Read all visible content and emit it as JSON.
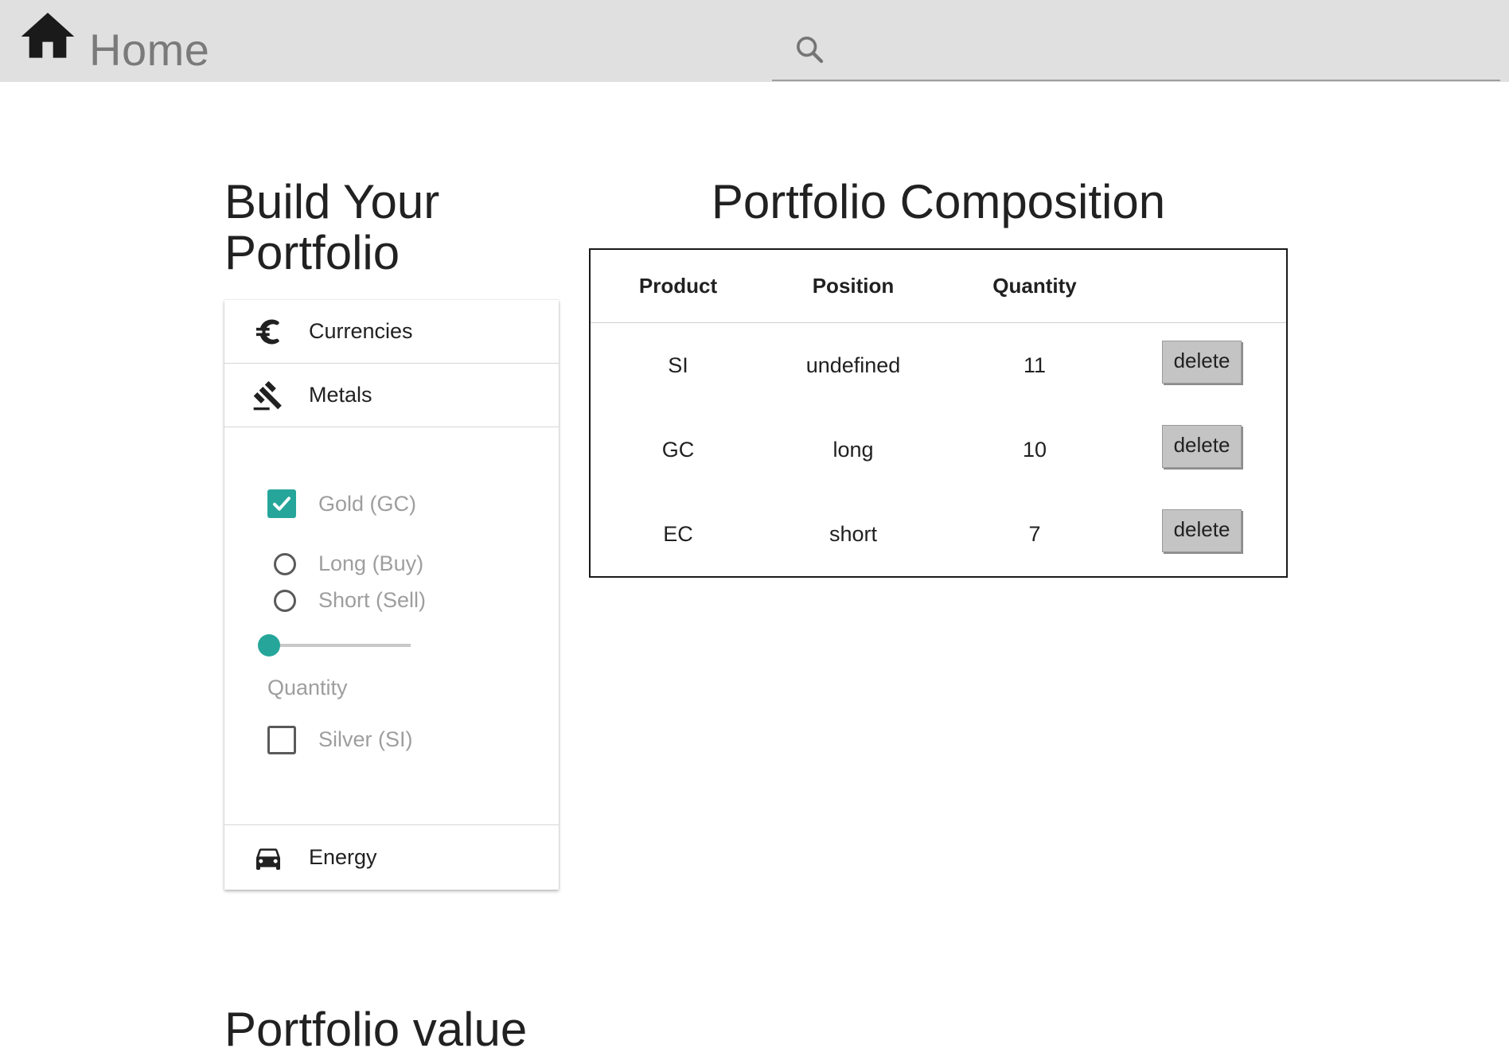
{
  "header": {
    "title": "Home",
    "home_icon": "home-icon",
    "search": {
      "icon": "search-icon",
      "value": "",
      "placeholder": ""
    }
  },
  "builder": {
    "heading": "Build Your Portfolio",
    "sections": [
      {
        "label": "Currencies",
        "icon": "euro-icon"
      },
      {
        "label": "Metals",
        "icon": "gavel-icon"
      },
      {
        "label": "Energy",
        "icon": "car-icon"
      }
    ],
    "metals_panel": {
      "gold": {
        "label": "Gold (GC)",
        "checked": true
      },
      "position_options": [
        {
          "label": "Long (Buy)",
          "selected": false
        },
        {
          "label": "Short (Sell)",
          "selected": false
        }
      ],
      "quantity_label": "Quantity",
      "quantity_slider": {
        "value": 0,
        "fraction": 0.0
      },
      "silver": {
        "label": "Silver (SI)",
        "checked": false
      }
    }
  },
  "composition": {
    "heading": "Portfolio Composition",
    "columns": [
      "Product",
      "Position",
      "Quantity",
      ""
    ],
    "rows": [
      {
        "product": "SI",
        "position": "undefined",
        "quantity": "11",
        "action": "delete"
      },
      {
        "product": "GC",
        "position": "long",
        "quantity": "10",
        "action": "delete"
      },
      {
        "product": "EC",
        "position": "short",
        "quantity": "7",
        "action": "delete"
      }
    ]
  },
  "value_section": {
    "heading": "Portfolio value"
  },
  "colors": {
    "accent": "#26a69a",
    "topbar": "#e0e0e0",
    "muted_text": "#9e9e9e"
  }
}
